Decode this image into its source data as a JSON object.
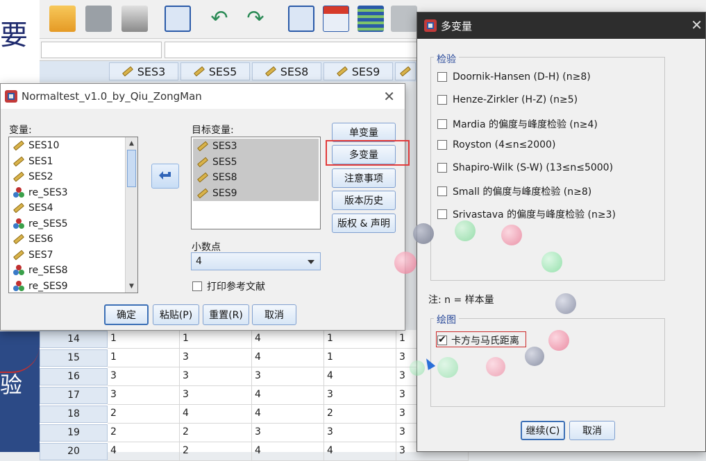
{
  "background": {
    "slide_title_fragment": "要",
    "slide_bottom_text": "验",
    "variable_columns": [
      "SES3",
      "SES5",
      "SES8",
      "SES9"
    ],
    "rows": [
      {
        "n": "14",
        "cells": [
          "1",
          "1",
          "4",
          "1",
          "1"
        ]
      },
      {
        "n": "15",
        "cells": [
          "1",
          "3",
          "4",
          "1",
          "3"
        ]
      },
      {
        "n": "16",
        "cells": [
          "3",
          "3",
          "3",
          "4",
          "3"
        ]
      },
      {
        "n": "17",
        "cells": [
          "3",
          "3",
          "4",
          "3",
          "3"
        ]
      },
      {
        "n": "18",
        "cells": [
          "2",
          "4",
          "4",
          "2",
          "3"
        ]
      },
      {
        "n": "19",
        "cells": [
          "2",
          "2",
          "3",
          "3",
          "3"
        ]
      },
      {
        "n": "20",
        "cells": [
          "4",
          "2",
          "4",
          "4",
          "3"
        ]
      }
    ]
  },
  "normaltest_dialog": {
    "title": "Normaltest_v1.0_by_Qiu_ZongMan",
    "variables_label": "变量:",
    "variables": [
      {
        "name": "SES10",
        "type": "scale"
      },
      {
        "name": "SES1",
        "type": "scale"
      },
      {
        "name": "SES2",
        "type": "scale"
      },
      {
        "name": "re_SES3",
        "type": "nominal"
      },
      {
        "name": "SES4",
        "type": "scale"
      },
      {
        "name": "re_SES5",
        "type": "nominal"
      },
      {
        "name": "SES6",
        "type": "scale"
      },
      {
        "name": "SES7",
        "type": "scale"
      },
      {
        "name": "re_SES8",
        "type": "nominal"
      },
      {
        "name": "re_SES9",
        "type": "nominal"
      }
    ],
    "target_label": "目标变量:",
    "targets": [
      "SES3",
      "SES5",
      "SES8",
      "SES9"
    ],
    "side_buttons": [
      "单变量",
      "多变量",
      "注意事项",
      "版本历史",
      "版权 & 声明"
    ],
    "decimals_label": "小数点",
    "decimals_value": "4",
    "print_refs_label": "打印参考文献",
    "bottom_buttons": {
      "ok": "确定",
      "paste": "粘贴(P)",
      "reset": "重置(R)",
      "cancel": "取消"
    }
  },
  "multivariate_dialog": {
    "title": "多变量",
    "tests_group": "检验",
    "tests": [
      {
        "label": "Doornik-Hansen (D-H) (n≥8)",
        "checked": false
      },
      {
        "label": "Henze-Zirkler (H-Z) (n≥5)",
        "checked": false
      },
      {
        "label": "Mardia 的偏度与峰度检验 (n≥4)",
        "checked": false
      },
      {
        "label": "Royston (4≤n≤2000)",
        "checked": false
      },
      {
        "label": "Shapiro-Wilk (S-W) (13≤n≤5000)",
        "checked": false
      },
      {
        "label": "Small 的偏度与峰度检验 (n≥8)",
        "checked": false
      },
      {
        "label": "Srivastava 的偏度与峰度检验 (n≥3)",
        "checked": false
      }
    ],
    "note": "注: n = 样本量",
    "plot_group": "绘图",
    "plot_option": {
      "label": "卡方与马氏距离",
      "checked": true
    },
    "continue_button": "继续(C)",
    "cancel_button": "取消"
  },
  "colors": {
    "accent": "#3b6fb6",
    "highlight_box": "#e23b3b",
    "dark_titlebar": "#2d2d2d"
  }
}
